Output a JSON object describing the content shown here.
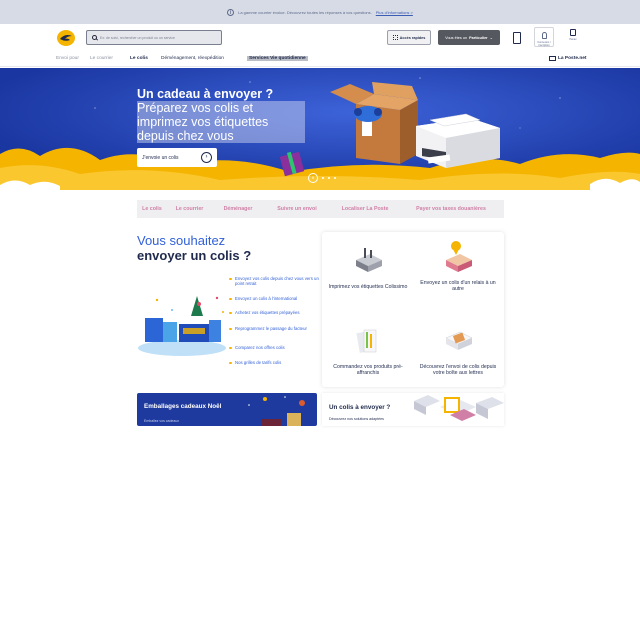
{
  "colors": {
    "brand_blue": "#1e3fb3",
    "brand_yellow": "#f4b400",
    "accent_pink": "#d07fa6",
    "link_blue": "#3160d8",
    "navy": "#1f2a4d"
  },
  "infobar": {
    "icon": "info-icon",
    "text": "La gamme courrier évolue. Découvrez toutes les réponses à vos questions.",
    "link": "Plus d'informations >"
  },
  "header": {
    "logo": "la-poste-logo",
    "search": {
      "placeholder": "Ex: de suivi, rechercher un produit ou un service",
      "icon": "search-icon"
    },
    "quick_access": {
      "label": "Accès rapides",
      "icon": "grid-icon"
    },
    "profile": {
      "prefix": "Vous êtes un",
      "value": "Particulier",
      "icon": "chevron-down-icon"
    },
    "accessibility_icon": "accessibility-icon",
    "account": {
      "icon": "user-icon",
      "label": "Connexion / Inscription"
    },
    "cart": {
      "icon": "cart-icon",
      "label": "Panier"
    }
  },
  "nav": {
    "items": [
      {
        "label": "Envoi pour"
      },
      {
        "label": "Le courrier"
      },
      {
        "label": "Le colis"
      },
      {
        "label": "Déménagement, réexpédition"
      },
      {
        "label": "Services Vie quotidienne"
      }
    ],
    "laposte_net": "La Poste.net"
  },
  "hero": {
    "title": "Un cadeau à envoyer ?",
    "subtitle": "Préparez vos colis et imprimez vos étiquettes depuis chez vous",
    "cta": "J'envoie un colis",
    "pause_icon": "pause-icon"
  },
  "tabs": [
    "Le colis",
    "Le courrier",
    "Déménager",
    "Suivre un envoi",
    "Localiser La Poste",
    "Payer vos taxes douanières"
  ],
  "send_section": {
    "title_line1": "Vous souhaitez",
    "title_line2": "envoyer un colis ?",
    "links": [
      "Envoyez vos colis depuis chez vous vers un point retrait",
      "Envoyez un colis à l'international",
      "Achetez vos étiquettes prépayées",
      "Reprogrammez le passage du facteur",
      "Comparez nos offres colis",
      "Nos grilles de tarifs colis"
    ]
  },
  "services": [
    {
      "label": "Imprimez vos étiquettes Colissimo",
      "icon": "printer-icon"
    },
    {
      "label": "Envoyez un colis d'un relais à un autre",
      "icon": "relay-point-icon"
    },
    {
      "label": "Commandez vos produits pré-affranchis",
      "icon": "prepaid-envelopes-icon"
    },
    {
      "label": "Découvrez l'envoi de colis depuis votre boîte aux lettres",
      "icon": "parcel-mailbox-icon"
    }
  ],
  "banners": {
    "gifts": {
      "title": "Emballages cadeaux Noël",
      "subtitle": "Emballez vos cadeaux"
    },
    "parcel": {
      "title": "Un colis à envoyer ?",
      "subtitle": "Découvrez nos solutions adaptées"
    }
  }
}
